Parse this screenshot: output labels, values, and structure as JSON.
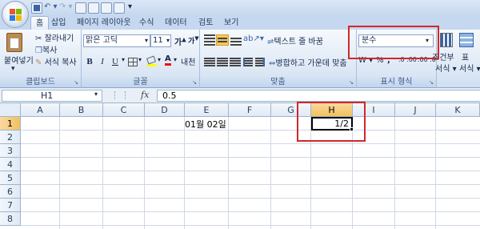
{
  "tabs": [
    "홈",
    "삽입",
    "페이지 레이아웃",
    "수식",
    "데이터",
    "검토",
    "보기"
  ],
  "clipboard": {
    "paste_label": "붙여넣기",
    "cut_label": "잘라내기",
    "copy_label": "복사",
    "format_painter_label": "서식 복사",
    "group_label": "클립보드"
  },
  "font": {
    "name": "맑은 고딕",
    "size": "11",
    "bold": "B",
    "italic": "I",
    "underline": "U",
    "group_label": "글꼴",
    "phonetic": "내천"
  },
  "alignment": {
    "wrap_text_label": "텍스트 줄 바꿈",
    "merge_center_label": "병합하고 가운데 맞춤",
    "group_label": "맞춤"
  },
  "number": {
    "format_value": "분수",
    "percent": "%",
    "group_label": "표시 형식"
  },
  "styles": {
    "conditional_label": "조건부",
    "conditional_label2": "서식 ▾",
    "table_label": "표",
    "table_label2": "서식 ▾"
  },
  "formula_bar": {
    "cell_ref": "H1",
    "fx": "fx",
    "value": "0.5"
  },
  "columns": [
    "A",
    "B",
    "C",
    "D",
    "E",
    "F",
    "G",
    "H",
    "I",
    "J",
    "K"
  ],
  "selected_column": "H",
  "rows": [
    "1",
    "2",
    "3",
    "4",
    "5",
    "6",
    "7",
    "8"
  ],
  "cells": {
    "E1": "01월 02일",
    "H1": "1/2"
  },
  "colors": {
    "highlight": "#d0282c",
    "selected_header": "#f1c15f"
  }
}
